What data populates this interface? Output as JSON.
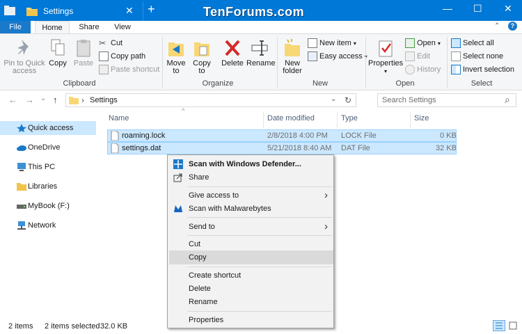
{
  "window": {
    "title": "Settings",
    "watermark": "TenForums.com",
    "new_tab": "+",
    "minimize": "—",
    "maximize": "☐",
    "close": "✕",
    "tab_close": "✕"
  },
  "ribbon_tabs": {
    "file": "File",
    "home": "Home",
    "share": "Share",
    "view": "View",
    "help": "?"
  },
  "ribbon": {
    "clipboard": {
      "label": "Clipboard",
      "pin": "Pin to Quick access",
      "copy": "Copy",
      "paste": "Paste",
      "cut": "Cut",
      "copy_path": "Copy path",
      "paste_shortcut": "Paste shortcut"
    },
    "organize": {
      "label": "Organize",
      "move_to": "Move to",
      "copy_to": "Copy to",
      "delete": "Delete",
      "rename": "Rename"
    },
    "new": {
      "label": "New",
      "new_folder": "New folder",
      "new_item": "New item",
      "easy_access": "Easy access"
    },
    "open": {
      "label": "Open",
      "properties": "Properties",
      "open": "Open",
      "edit": "Edit",
      "history": "History"
    },
    "select": {
      "label": "Select",
      "select_all": "Select all",
      "select_none": "Select none",
      "invert_selection": "Invert selection"
    }
  },
  "address": {
    "back": "←",
    "forward": "→",
    "recent": "⌄",
    "up": "↑",
    "path_sep": "›",
    "path": "Settings",
    "dropdown": "⌄",
    "refresh": "↻",
    "search_placeholder": "Search Settings",
    "search_icon": "⌕"
  },
  "nav": {
    "items": [
      {
        "label": "Quick access",
        "icon": "star-icon"
      },
      {
        "label": "OneDrive",
        "icon": "cloud-icon"
      },
      {
        "label": "This PC",
        "icon": "computer-icon"
      },
      {
        "label": "Libraries",
        "icon": "library-icon"
      },
      {
        "label": "MyBook (F:)",
        "icon": "drive-icon"
      },
      {
        "label": "Network",
        "icon": "network-icon"
      }
    ]
  },
  "columns": {
    "name": "Name",
    "date": "Date modified",
    "type": "Type",
    "size": "Size"
  },
  "files": [
    {
      "name": "roaming.lock",
      "date": "2/8/2018 4:00 PM",
      "type": "LOCK File",
      "size": "0 KB"
    },
    {
      "name": "settings.dat",
      "date": "5/21/2018 8:40 AM",
      "type": "DAT File",
      "size": "32 KB"
    }
  ],
  "context_menu": {
    "scan_defender": "Scan with Windows Defender...",
    "share": "Share",
    "give_access": "Give access to",
    "scan_malwarebytes": "Scan with Malwarebytes",
    "send_to": "Send to",
    "cut": "Cut",
    "copy": "Copy",
    "create_shortcut": "Create shortcut",
    "delete": "Delete",
    "rename": "Rename",
    "properties": "Properties",
    "arrow": "›"
  },
  "status": {
    "items": "2 items",
    "selected": "2 items selected",
    "size": "32.0 KB"
  },
  "colors": {
    "accent": "#0078d7",
    "selection": "#cce8ff",
    "menu_bg": "#f2f2f2"
  }
}
